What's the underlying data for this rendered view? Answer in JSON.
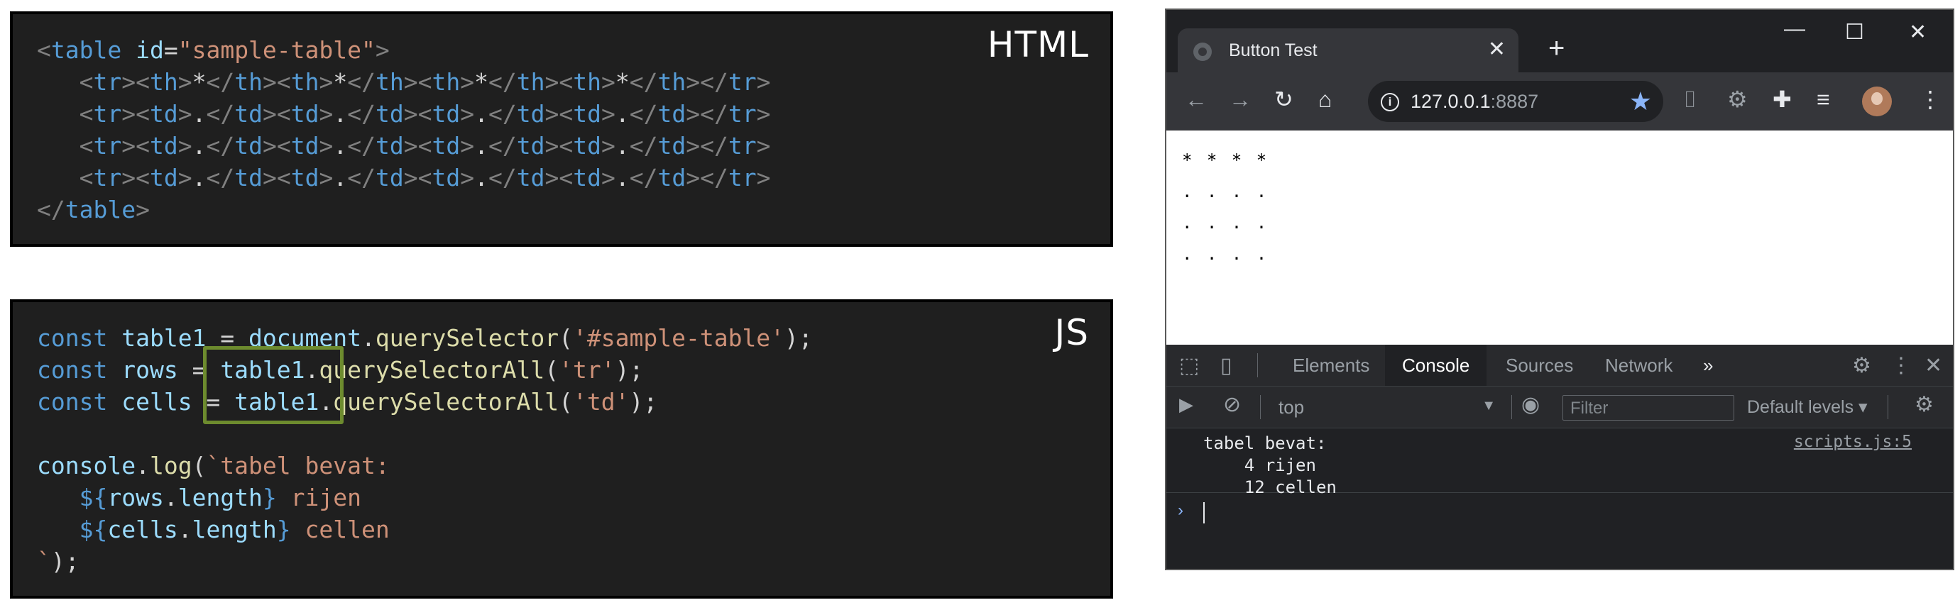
{
  "html_panel": {
    "tag": "HTML",
    "lines": [
      [
        {
          "t": "<",
          "c": "br"
        },
        {
          "t": "table",
          "c": "tg"
        },
        {
          "t": " ",
          "c": "pl"
        },
        {
          "t": "id",
          "c": "at"
        },
        {
          "t": "=",
          "c": "pl"
        },
        {
          "t": "\"sample-table\"",
          "c": "st"
        },
        {
          "t": ">",
          "c": "br"
        }
      ],
      [
        {
          "t": "   ",
          "c": "pl"
        },
        {
          "t": "<",
          "c": "br"
        },
        {
          "t": "tr",
          "c": "tg"
        },
        {
          "t": ">",
          "c": "br"
        },
        {
          "t": "<",
          "c": "br"
        },
        {
          "t": "th",
          "c": "tg"
        },
        {
          "t": ">",
          "c": "br"
        },
        {
          "t": "*",
          "c": "pl"
        },
        {
          "t": "</",
          "c": "br"
        },
        {
          "t": "th",
          "c": "tg"
        },
        {
          "t": ">",
          "c": "br"
        },
        {
          "t": "<",
          "c": "br"
        },
        {
          "t": "th",
          "c": "tg"
        },
        {
          "t": ">",
          "c": "br"
        },
        {
          "t": "*",
          "c": "pl"
        },
        {
          "t": "</",
          "c": "br"
        },
        {
          "t": "th",
          "c": "tg"
        },
        {
          "t": ">",
          "c": "br"
        },
        {
          "t": "<",
          "c": "br"
        },
        {
          "t": "th",
          "c": "tg"
        },
        {
          "t": ">",
          "c": "br"
        },
        {
          "t": "*",
          "c": "pl"
        },
        {
          "t": "</",
          "c": "br"
        },
        {
          "t": "th",
          "c": "tg"
        },
        {
          "t": ">",
          "c": "br"
        },
        {
          "t": "<",
          "c": "br"
        },
        {
          "t": "th",
          "c": "tg"
        },
        {
          "t": ">",
          "c": "br"
        },
        {
          "t": "*",
          "c": "pl"
        },
        {
          "t": "</",
          "c": "br"
        },
        {
          "t": "th",
          "c": "tg"
        },
        {
          "t": ">",
          "c": "br"
        },
        {
          "t": "</",
          "c": "br"
        },
        {
          "t": "tr",
          "c": "tg"
        },
        {
          "t": ">",
          "c": "br"
        }
      ],
      [
        {
          "t": "   ",
          "c": "pl"
        },
        {
          "t": "<",
          "c": "br"
        },
        {
          "t": "tr",
          "c": "tg"
        },
        {
          "t": ">",
          "c": "br"
        },
        {
          "t": "<",
          "c": "br"
        },
        {
          "t": "td",
          "c": "tg"
        },
        {
          "t": ">",
          "c": "br"
        },
        {
          "t": ".",
          "c": "pl"
        },
        {
          "t": "</",
          "c": "br"
        },
        {
          "t": "td",
          "c": "tg"
        },
        {
          "t": ">",
          "c": "br"
        },
        {
          "t": "<",
          "c": "br"
        },
        {
          "t": "td",
          "c": "tg"
        },
        {
          "t": ">",
          "c": "br"
        },
        {
          "t": ".",
          "c": "pl"
        },
        {
          "t": "</",
          "c": "br"
        },
        {
          "t": "td",
          "c": "tg"
        },
        {
          "t": ">",
          "c": "br"
        },
        {
          "t": "<",
          "c": "br"
        },
        {
          "t": "td",
          "c": "tg"
        },
        {
          "t": ">",
          "c": "br"
        },
        {
          "t": ".",
          "c": "pl"
        },
        {
          "t": "</",
          "c": "br"
        },
        {
          "t": "td",
          "c": "tg"
        },
        {
          "t": ">",
          "c": "br"
        },
        {
          "t": "<",
          "c": "br"
        },
        {
          "t": "td",
          "c": "tg"
        },
        {
          "t": ">",
          "c": "br"
        },
        {
          "t": ".",
          "c": "pl"
        },
        {
          "t": "</",
          "c": "br"
        },
        {
          "t": "td",
          "c": "tg"
        },
        {
          "t": ">",
          "c": "br"
        },
        {
          "t": "</",
          "c": "br"
        },
        {
          "t": "tr",
          "c": "tg"
        },
        {
          "t": ">",
          "c": "br"
        }
      ],
      [
        {
          "t": "   ",
          "c": "pl"
        },
        {
          "t": "<",
          "c": "br"
        },
        {
          "t": "tr",
          "c": "tg"
        },
        {
          "t": ">",
          "c": "br"
        },
        {
          "t": "<",
          "c": "br"
        },
        {
          "t": "td",
          "c": "tg"
        },
        {
          "t": ">",
          "c": "br"
        },
        {
          "t": ".",
          "c": "pl"
        },
        {
          "t": "</",
          "c": "br"
        },
        {
          "t": "td",
          "c": "tg"
        },
        {
          "t": ">",
          "c": "br"
        },
        {
          "t": "<",
          "c": "br"
        },
        {
          "t": "td",
          "c": "tg"
        },
        {
          "t": ">",
          "c": "br"
        },
        {
          "t": ".",
          "c": "pl"
        },
        {
          "t": "</",
          "c": "br"
        },
        {
          "t": "td",
          "c": "tg"
        },
        {
          "t": ">",
          "c": "br"
        },
        {
          "t": "<",
          "c": "br"
        },
        {
          "t": "td",
          "c": "tg"
        },
        {
          "t": ">",
          "c": "br"
        },
        {
          "t": ".",
          "c": "pl"
        },
        {
          "t": "</",
          "c": "br"
        },
        {
          "t": "td",
          "c": "tg"
        },
        {
          "t": ">",
          "c": "br"
        },
        {
          "t": "<",
          "c": "br"
        },
        {
          "t": "td",
          "c": "tg"
        },
        {
          "t": ">",
          "c": "br"
        },
        {
          "t": ".",
          "c": "pl"
        },
        {
          "t": "</",
          "c": "br"
        },
        {
          "t": "td",
          "c": "tg"
        },
        {
          "t": ">",
          "c": "br"
        },
        {
          "t": "</",
          "c": "br"
        },
        {
          "t": "tr",
          "c": "tg"
        },
        {
          "t": ">",
          "c": "br"
        }
      ],
      [
        {
          "t": "   ",
          "c": "pl"
        },
        {
          "t": "<",
          "c": "br"
        },
        {
          "t": "tr",
          "c": "tg"
        },
        {
          "t": ">",
          "c": "br"
        },
        {
          "t": "<",
          "c": "br"
        },
        {
          "t": "td",
          "c": "tg"
        },
        {
          "t": ">",
          "c": "br"
        },
        {
          "t": ".",
          "c": "pl"
        },
        {
          "t": "</",
          "c": "br"
        },
        {
          "t": "td",
          "c": "tg"
        },
        {
          "t": ">",
          "c": "br"
        },
        {
          "t": "<",
          "c": "br"
        },
        {
          "t": "td",
          "c": "tg"
        },
        {
          "t": ">",
          "c": "br"
        },
        {
          "t": ".",
          "c": "pl"
        },
        {
          "t": "</",
          "c": "br"
        },
        {
          "t": "td",
          "c": "tg"
        },
        {
          "t": ">",
          "c": "br"
        },
        {
          "t": "<",
          "c": "br"
        },
        {
          "t": "td",
          "c": "tg"
        },
        {
          "t": ">",
          "c": "br"
        },
        {
          "t": ".",
          "c": "pl"
        },
        {
          "t": "</",
          "c": "br"
        },
        {
          "t": "td",
          "c": "tg"
        },
        {
          "t": ">",
          "c": "br"
        },
        {
          "t": "<",
          "c": "br"
        },
        {
          "t": "td",
          "c": "tg"
        },
        {
          "t": ">",
          "c": "br"
        },
        {
          "t": ".",
          "c": "pl"
        },
        {
          "t": "</",
          "c": "br"
        },
        {
          "t": "td",
          "c": "tg"
        },
        {
          "t": ">",
          "c": "br"
        },
        {
          "t": "</",
          "c": "br"
        },
        {
          "t": "tr",
          "c": "tg"
        },
        {
          "t": ">",
          "c": "br"
        }
      ],
      [
        {
          "t": "</",
          "c": "br"
        },
        {
          "t": "table",
          "c": "tg"
        },
        {
          "t": ">",
          "c": "br"
        }
      ]
    ]
  },
  "js_panel": {
    "tag": "JS",
    "lines": [
      [
        {
          "t": "const",
          "c": "kw"
        },
        {
          "t": " ",
          "c": "pl"
        },
        {
          "t": "table1",
          "c": "vr"
        },
        {
          "t": " = ",
          "c": "pl"
        },
        {
          "t": "document",
          "c": "vr"
        },
        {
          "t": ".",
          "c": "pl"
        },
        {
          "t": "querySelector",
          "c": "fn"
        },
        {
          "t": "(",
          "c": "pl"
        },
        {
          "t": "'#sample-table'",
          "c": "st"
        },
        {
          "t": ");",
          "c": "pl"
        }
      ],
      [
        {
          "t": "const",
          "c": "kw"
        },
        {
          "t": " ",
          "c": "pl"
        },
        {
          "t": "rows",
          "c": "vr"
        },
        {
          "t": " = ",
          "c": "pl"
        },
        {
          "t": "table1",
          "c": "vr"
        },
        {
          "t": ".",
          "c": "pl"
        },
        {
          "t": "querySelectorAll",
          "c": "fn"
        },
        {
          "t": "(",
          "c": "pl"
        },
        {
          "t": "'tr'",
          "c": "st"
        },
        {
          "t": ");",
          "c": "pl"
        }
      ],
      [
        {
          "t": "const",
          "c": "kw"
        },
        {
          "t": " ",
          "c": "pl"
        },
        {
          "t": "cells",
          "c": "vr"
        },
        {
          "t": " = ",
          "c": "pl"
        },
        {
          "t": "table1",
          "c": "vr"
        },
        {
          "t": ".",
          "c": "pl"
        },
        {
          "t": "querySelectorAll",
          "c": "fn"
        },
        {
          "t": "(",
          "c": "pl"
        },
        {
          "t": "'td'",
          "c": "st"
        },
        {
          "t": ");",
          "c": "pl"
        }
      ],
      [
        {
          "t": "",
          "c": "pl"
        }
      ],
      [
        {
          "t": "console",
          "c": "vr"
        },
        {
          "t": ".",
          "c": "pl"
        },
        {
          "t": "log",
          "c": "fn"
        },
        {
          "t": "(",
          "c": "pl"
        },
        {
          "t": "`tabel bevat:",
          "c": "st"
        }
      ],
      [
        {
          "t": "   ",
          "c": "pl"
        },
        {
          "t": "${",
          "c": "kw"
        },
        {
          "t": "rows",
          "c": "vr"
        },
        {
          "t": ".",
          "c": "pl"
        },
        {
          "t": "length",
          "c": "vr"
        },
        {
          "t": "}",
          "c": "kw"
        },
        {
          "t": " rijen",
          "c": "st"
        }
      ],
      [
        {
          "t": "   ",
          "c": "pl"
        },
        {
          "t": "${",
          "c": "kw"
        },
        {
          "t": "cells",
          "c": "vr"
        },
        {
          "t": ".",
          "c": "pl"
        },
        {
          "t": "length",
          "c": "vr"
        },
        {
          "t": "}",
          "c": "kw"
        },
        {
          "t": " cellen",
          "c": "st"
        }
      ],
      [
        {
          "t": "`",
          "c": "st"
        },
        {
          "t": ");",
          "c": "pl"
        }
      ]
    ]
  },
  "browser": {
    "tab_title": "Button Test",
    "tab_close": "✕",
    "new_tab": "+",
    "window": {
      "minimize": "—",
      "maximize": "☐",
      "close": "✕"
    },
    "toolbar": {
      "back": "←",
      "forward": "→",
      "reload": "↻",
      "home": "⌂",
      "url_host": "127.0.0.1",
      "url_port": ":8887",
      "star": "★",
      "camera": "⌷",
      "gear": "⚙",
      "puzzle": "✚",
      "media": "≡",
      "menu": "⋮"
    },
    "page_rows": [
      "* * * *",
      ". . . .",
      ". . . .",
      ". . . ."
    ],
    "devtools": {
      "inspect_icon": "⬚",
      "device_icon": "▯",
      "tabs": [
        "Elements",
        "Console",
        "Sources",
        "Network"
      ],
      "active_tab": "Console",
      "more": "»",
      "settings": "⚙",
      "kebab": "⋮",
      "close": "✕",
      "sidebar_icon": "▶",
      "clear_icon": "⊘",
      "context": "top",
      "context_arrow": "▼",
      "eye_icon": "◉",
      "filter_placeholder": "Filter",
      "levels": "Default levels ▾",
      "log_text": "tabel bevat:\n    4 rijen\n    12 cellen",
      "log_source": "scripts.js:5",
      "prompt": "›"
    }
  }
}
